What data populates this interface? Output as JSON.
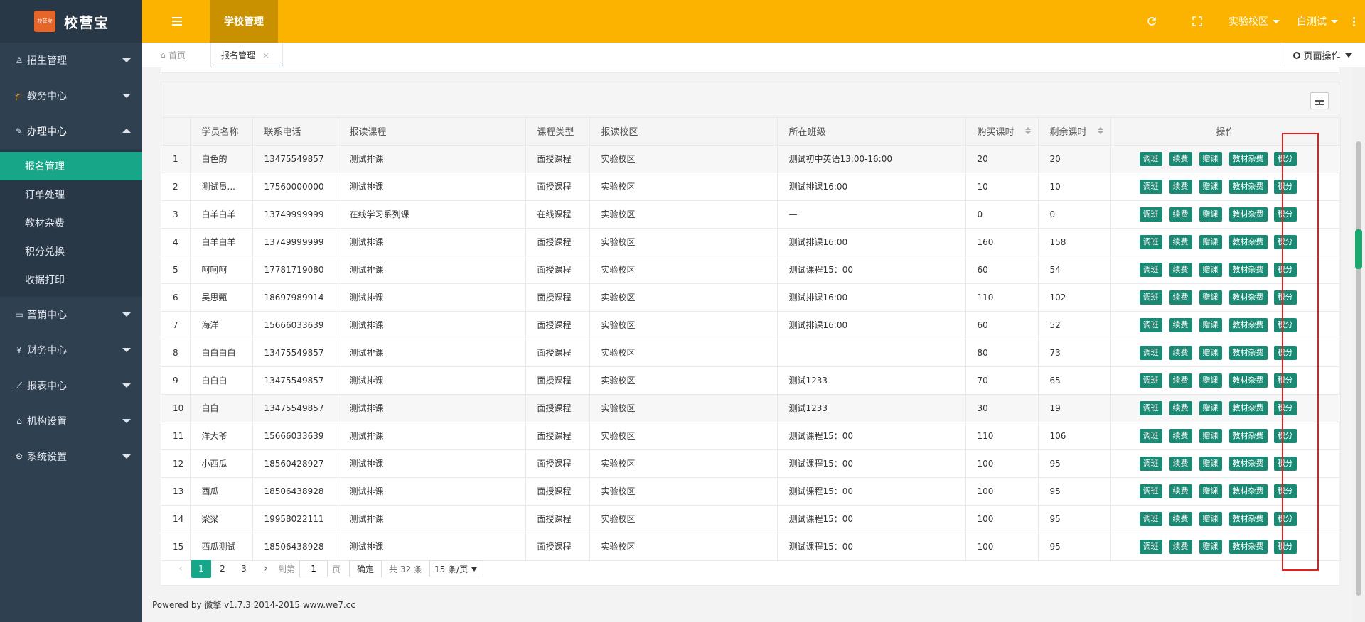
{
  "brand": {
    "logo_small": "校营宝",
    "name": "校营宝"
  },
  "sidebar": {
    "items": [
      {
        "label": "招生管理",
        "icon": "person-icon"
      },
      {
        "label": "教务中心",
        "icon": "graduation-cap-icon"
      },
      {
        "label": "办理中心",
        "icon": "edit-icon",
        "open": true
      },
      {
        "label": "营销中心",
        "icon": "laptop-icon"
      },
      {
        "label": "财务中心",
        "icon": "yen-icon"
      },
      {
        "label": "报表中心",
        "icon": "line-chart-icon"
      },
      {
        "label": "机构设置",
        "icon": "bank-icon"
      },
      {
        "label": "系统设置",
        "icon": "cogs-icon"
      }
    ],
    "submenu": [
      "报名管理",
      "订单处理",
      "教材杂费",
      "积分兑换",
      "收据打印"
    ]
  },
  "header": {
    "active_tab": "学校管理",
    "campus": "实验校区",
    "user": "白测试"
  },
  "tabs": {
    "home": "首页",
    "current": "报名管理",
    "page_ops": "页面操作"
  },
  "table": {
    "headers": [
      "",
      "学员名称",
      "联系电话",
      "报读课程",
      "课程类型",
      "报读校区",
      "所在班级",
      "购买课时",
      "剩余课时",
      "操作"
    ],
    "actions": [
      "调班",
      "续费",
      "赠课",
      "教材杂费",
      "积分"
    ],
    "rows": [
      [
        "1",
        "白色的",
        "13475549857",
        "测试排课",
        "面授课程",
        "实验校区",
        "测试初中英语13:00-16:00",
        "20",
        "20"
      ],
      [
        "2",
        "测试员...",
        "17560000000",
        "测试排课",
        "面授课程",
        "实验校区",
        "测试排课16:00",
        "10",
        "10"
      ],
      [
        "3",
        "白羊白羊",
        "13749999999",
        "在线学习系列课",
        "在线课程",
        "实验校区",
        "—",
        "0",
        "0"
      ],
      [
        "4",
        "白羊白羊",
        "13749999999",
        "测试排课",
        "面授课程",
        "实验校区",
        "测试排课16:00",
        "160",
        "158"
      ],
      [
        "5",
        "呵呵呵",
        "17781719080",
        "测试排课",
        "面授课程",
        "实验校区",
        "测试课程15：00",
        "60",
        "54"
      ],
      [
        "6",
        "吴思甄",
        "18697989914",
        "测试排课",
        "面授课程",
        "实验校区",
        "测试排课16:00",
        "110",
        "102"
      ],
      [
        "7",
        "海洋",
        "15666033639",
        "测试排课",
        "面授课程",
        "实验校区",
        "测试排课16:00",
        "60",
        "52"
      ],
      [
        "8",
        "白白白白",
        "13475549857",
        "测试排课",
        "面授课程",
        "实验校区",
        "",
        "80",
        "73"
      ],
      [
        "9",
        "白白白",
        "13475549857",
        "测试排课",
        "面授课程",
        "实验校区",
        "测试1233",
        "70",
        "65"
      ],
      [
        "10",
        "白白",
        "13475549857",
        "测试排课",
        "面授课程",
        "实验校区",
        "测试1233",
        "30",
        "19"
      ],
      [
        "11",
        "洋大爷",
        "15666033639",
        "测试排课",
        "面授课程",
        "实验校区",
        "测试课程15：00",
        "110",
        "106"
      ],
      [
        "12",
        "小西瓜",
        "18560428927",
        "测试排课",
        "面授课程",
        "实验校区",
        "测试课程15：00",
        "100",
        "95"
      ],
      [
        "13",
        "西瓜",
        "18506438928",
        "测试排课",
        "面授课程",
        "实验校区",
        "测试课程15：00",
        "100",
        "95"
      ],
      [
        "14",
        "梁梁",
        "19958022111",
        "测试排课",
        "面授课程",
        "实验校区",
        "测试课程15：00",
        "100",
        "95"
      ],
      [
        "15",
        "西瓜测试",
        "18506438928",
        "测试排课",
        "面授课程",
        "实验校区",
        "测试课程15：00",
        "100",
        "95"
      ]
    ]
  },
  "pager": {
    "pages": [
      "1",
      "2",
      "3"
    ],
    "goto_label": "到第",
    "goto_value": "1",
    "page_unit": "页",
    "confirm": "确定",
    "total": "共 32 条",
    "page_size": "15 条/页"
  },
  "footer": "Powered by 微擎 v1.7.3 2014-2015 www.we7.cc",
  "colors": {
    "sidebar": "#2f4050",
    "header": "#fbb300",
    "accent": "#18a689",
    "highlight": "#e02020"
  }
}
